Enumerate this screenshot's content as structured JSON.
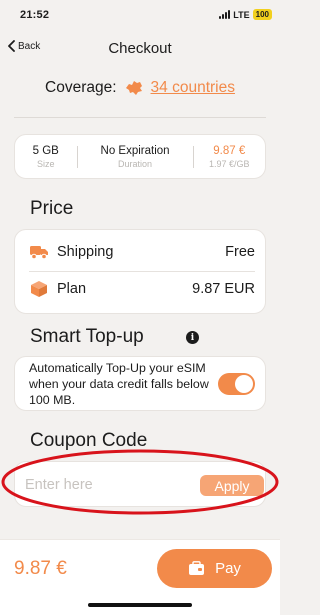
{
  "status_bar": {
    "time": "21:52",
    "network": "LTE",
    "battery": "100"
  },
  "nav": {
    "back_label": "Back",
    "title": "Checkout"
  },
  "coverage": {
    "label": "Coverage:",
    "link": "34 countries"
  },
  "plan_info": {
    "data_value": "5 GB",
    "data_caption": "Size",
    "duration_value": "No Expiration",
    "duration_caption": "Duration",
    "price_value": "9.87 €",
    "price_caption": "1.97 €/GB"
  },
  "price_section": {
    "title": "Price",
    "rows": [
      {
        "label": "Shipping",
        "value": "Free",
        "icon": "truck-icon"
      },
      {
        "label": "Plan",
        "value": "9.87 EUR",
        "icon": "package-icon"
      }
    ]
  },
  "smart_topup": {
    "title": "Smart Top-up",
    "info_glyph": "i",
    "description": "Automatically Top-Up your eSIM when your data credit falls below 100 MB.",
    "enabled": true
  },
  "coupon": {
    "title": "Coupon Code",
    "placeholder": "Enter here",
    "value": "",
    "apply_label": "Apply"
  },
  "footer": {
    "total": "9.87 €",
    "pay_label": "Pay"
  },
  "colors": {
    "accent": "#f28a4a",
    "accent_light": "#f6a575",
    "annotation": "#d8131b",
    "background": "#f3f1ef"
  }
}
